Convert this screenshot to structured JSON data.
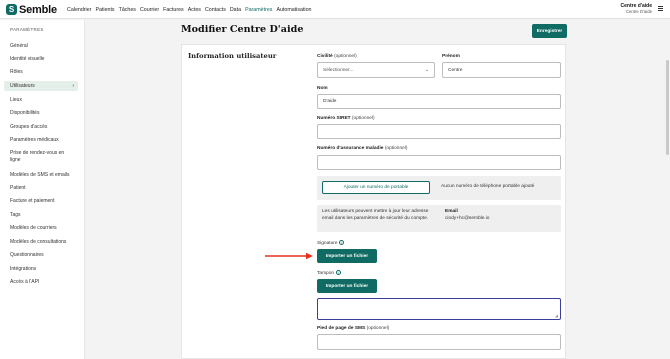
{
  "brand": {
    "name": "Semble",
    "color": "#0f6b63"
  },
  "nav": {
    "items": [
      "Calendrier",
      "Patients",
      "Tâches",
      "Courrier",
      "Factures",
      "Actes",
      "Contacts",
      "Data",
      "Paramètres",
      "Automatisation"
    ],
    "active": "Paramètres"
  },
  "account": {
    "name": "Centre d'aide",
    "sub": "Centre D'aide"
  },
  "sidebar": {
    "title": "PARAMÈTRES",
    "items": [
      "Général",
      "Identité visuelle",
      "Rôles",
      "Utilisateurs",
      "Lieux",
      "Disponibilités",
      "Groupes d'accès",
      "Paramètres médicaux",
      "Prise de rendez-vous en ligne",
      "Modèles de SMS et emails",
      "Patient",
      "Facture et paiement",
      "Tags",
      "Modèles de courriers",
      "Modèles de consultations",
      "Questionnaires",
      "Intégrations",
      "Accès à l'API"
    ],
    "active": "Utilisateurs"
  },
  "page": {
    "title": "Modifier Centre D'aide",
    "save_label": "Enregistrer"
  },
  "form": {
    "section_title": "Information utilisateur",
    "civilite": {
      "label": "Civilité",
      "optional": "(optionnel)",
      "placeholder": "Sélectionner..."
    },
    "prenom": {
      "label": "Prénom",
      "value": "Centre"
    },
    "nom": {
      "label": "Nom",
      "value": "D'aide"
    },
    "siret": {
      "label": "Numéro SIRET",
      "optional": "(optionnel)",
      "value": ""
    },
    "assurance": {
      "label": "Numéro d'assurance maladie",
      "optional": "(optionnel)",
      "value": ""
    },
    "phone": {
      "button": "Ajouter un numéro de portable",
      "status": "Aucun numéro de téléphone portable ajouté"
    },
    "email_panel": {
      "note": "Les utilisateurs peuvent mettre à jour leur adresse email dans les paramètres de sécurité du compte.",
      "label": "Email",
      "value": "cindy+hc@semble.io"
    },
    "signature": {
      "label": "Signature",
      "button": "Importer un fichier"
    },
    "tampon": {
      "label": "Tampon",
      "button": "Importer un fichier"
    },
    "sms_footer": {
      "label": "Pied de page de SMS",
      "optional": "(optionnel)",
      "value": ""
    }
  },
  "icons": {
    "info": "info-icon",
    "chevron": "chevron-down-icon",
    "menu": "menu-icon",
    "arrow": "red-arrow-icon"
  },
  "colors": {
    "accent": "#0f6b63",
    "arrow": "#e53020",
    "focus": "#3c3f9a"
  }
}
